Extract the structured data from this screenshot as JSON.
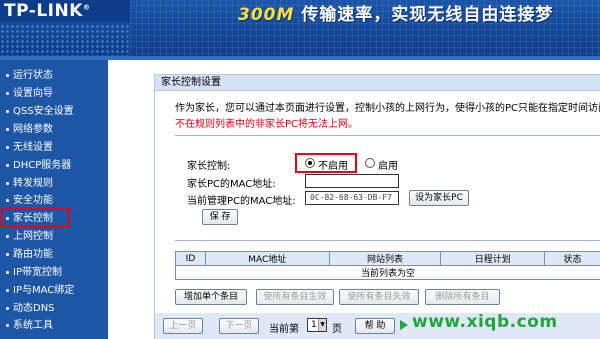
{
  "header": {
    "logo": "TP-LINK",
    "logo_mark": "®",
    "slogan_num": "300M",
    "slogan_text": "传输速率，实现无线自由连接梦"
  },
  "sidebar": {
    "items": [
      {
        "label": "运行状态"
      },
      {
        "label": "设置向导"
      },
      {
        "label": "QSS安全设置"
      },
      {
        "label": "网络参数"
      },
      {
        "label": "无线设置"
      },
      {
        "label": "DHCP服务器"
      },
      {
        "label": "转发规则"
      },
      {
        "label": "安全功能"
      },
      {
        "label": "家长控制"
      },
      {
        "label": "上网控制"
      },
      {
        "label": "路由功能"
      },
      {
        "label": "IP带宽控制"
      },
      {
        "label": "IP与MAC绑定"
      },
      {
        "label": "动态DNS"
      },
      {
        "label": "系统工具"
      }
    ]
  },
  "panel": {
    "title": "家长控制设置",
    "desc": "作为家长，您可以通过本页面进行设置，控制小孩的上网行为，使得小孩的PC只能在指定时间访问",
    "warning": "不在规则列表中的非家长PC将无法上网。",
    "control_label": "家长控制:",
    "option_off": "不启用",
    "option_on": "启用",
    "mac_label": "家长PC的MAC地址:",
    "mac_value": "",
    "current_mac_label": "当前管理PC的MAC地址:",
    "current_mac_value": "0C-82-68-63-DB-F7",
    "set_parent_button": "设为家长PC",
    "save_button": "保 存"
  },
  "table": {
    "headers": [
      "ID",
      "MAC地址",
      "网站列表",
      "日程计划",
      "状态"
    ],
    "empty_text": "当前列表为空"
  },
  "actions": {
    "add": "增加单个条目",
    "enable_all": "使所有条目生效",
    "disable_all": "使所有条目失效",
    "delete_all": "删除所有条目"
  },
  "pager": {
    "prev": "上一页",
    "next": "下一页",
    "current_label": "当前第",
    "page": "1",
    "page_unit": "页",
    "help": "帮 助"
  },
  "watermark": "www.xiqb.com",
  "colors": {
    "header_blue": "#1a55a8",
    "sidebar_blue": "#1d56a5",
    "highlight_red": "#e60012",
    "slogan_yellow": "#ffe13a",
    "watermark_green": "#1fa53b"
  }
}
